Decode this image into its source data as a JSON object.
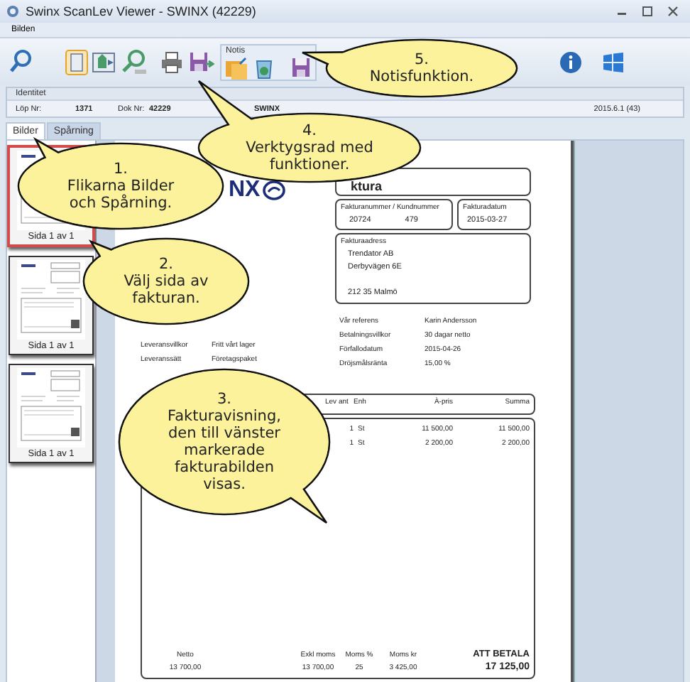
{
  "window": {
    "title": "Swinx ScanLev Viewer - SWINX (42229)"
  },
  "menu": [
    "Bilden"
  ],
  "toolbar": {
    "notis_group": {
      "title": "Notis"
    }
  },
  "identity": {
    "header": "Identitet",
    "fields": [
      {
        "label": "Löp Nr:",
        "value": "1371"
      },
      {
        "label": "Dok Nr:",
        "value": "42229"
      }
    ],
    "company": "SWINX",
    "version": "2015.6.1 (43)"
  },
  "tabs": [
    {
      "label": "Bilder",
      "selected": true
    },
    {
      "label": "Spårning",
      "selected": false
    }
  ],
  "thumbnails": [
    {
      "caption": "Sida 1 av 1",
      "selected": true
    },
    {
      "caption": "Sida 1 av 1",
      "selected": false
    },
    {
      "caption": "Sida 1 av 1",
      "selected": false
    }
  ],
  "invoice": {
    "logo": "NX",
    "title": "ktura",
    "number_box": {
      "label": "Fakturanummer / Kundnummer",
      "invoice_no": "20724",
      "customer_no": "479"
    },
    "date_box": {
      "label": "Fakturadatum",
      "value": "2015-03-27"
    },
    "address": {
      "label": "Fakturaadress",
      "lines": [
        "Trendator AB",
        "Derbyvägen 6E",
        "212 35  Malmö"
      ]
    },
    "left_info": [
      {
        "label": "Leveransvillkor",
        "value": "Fritt vårt lager"
      },
      {
        "label": "Leveranssätt",
        "value": "Företagspaket"
      }
    ],
    "right_info": [
      {
        "label": "Vår referens",
        "value": "Karin Andersson"
      },
      {
        "label": "Betalningsvillkor",
        "value": "30 dagar netto"
      },
      {
        "label": "Förfallodatum",
        "value": "2015-04-26"
      },
      {
        "label": "Dröjsmålsränta",
        "value": "15,00 %"
      }
    ],
    "columns": [
      "Lev ant",
      "Enh",
      "À-pris",
      "Summa"
    ],
    "rows": [
      [
        "1",
        "St",
        "11 500,00",
        "11 500,00"
      ],
      [
        "1",
        "St",
        "2 200,00",
        "2 200,00"
      ]
    ],
    "totals": [
      {
        "label": "Netto",
        "value": "13 700,00"
      },
      {
        "label": "Exkl moms",
        "value": "13 700,00"
      },
      {
        "label": "Moms %",
        "value": "25"
      },
      {
        "label": "Moms kr",
        "value": "3 425,00"
      }
    ],
    "to_pay": {
      "label": "ATT BETALA",
      "value": "17 125,00"
    }
  },
  "callouts": [
    {
      "lines": [
        "1.",
        "Flikarna Bilder",
        "och Spårning."
      ]
    },
    {
      "lines": [
        "2.",
        "Välj sida av",
        "fakturan."
      ]
    },
    {
      "lines": [
        "3.",
        "Fakturavisning,",
        "den till vänster",
        "markerade",
        "fakturabilden",
        "visas."
      ]
    },
    {
      "lines": [
        "4.",
        "Verktygsrad med",
        "funktioner."
      ]
    },
    {
      "lines": [
        "5.",
        "Notisfunktion."
      ]
    }
  ]
}
